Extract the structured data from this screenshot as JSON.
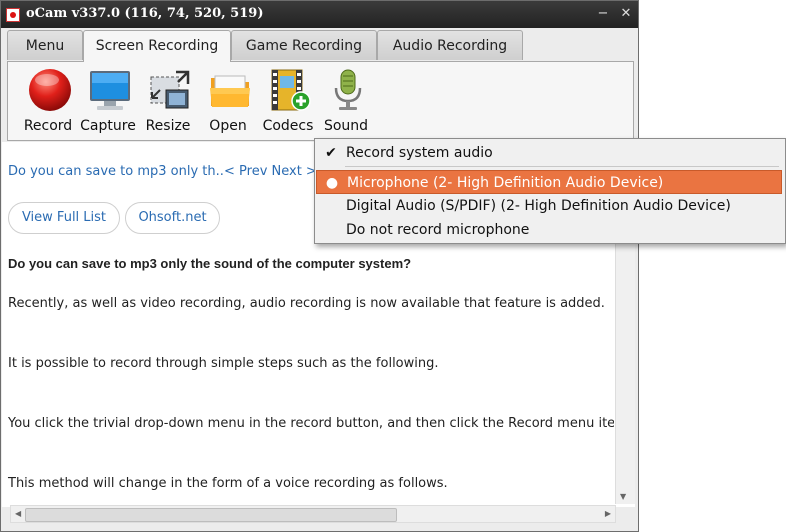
{
  "window": {
    "title": "oCam v337.0 (116, 74, 520, 519)"
  },
  "titlebar_buttons": {
    "minimize": "−",
    "maximize": "□",
    "close": "✕"
  },
  "tabs": [
    {
      "label": "Menu"
    },
    {
      "label": "Screen Recording"
    },
    {
      "label": "Game Recording"
    },
    {
      "label": "Audio Recording"
    }
  ],
  "toolbar": {
    "record": "Record",
    "capture": "Capture",
    "resize": "Resize",
    "open": "Open",
    "codecs": "Codecs",
    "sound": "Sound"
  },
  "content": {
    "faq_link": "Do you can save to mp3 only th..",
    "prev_next": "< Prev Next >",
    "view_full_list": "View Full List",
    "ohsoft": "Ohsoft.net",
    "heading": "Do you can save to mp3 only the sound of the computer system?",
    "p1": "Recently, as well as video recording, audio recording is now available that feature is added.",
    "p2": "It is possible to record through simple steps such as the following.",
    "p3": "You click the trivial drop-down menu in the record button, and then click the Record menu item onl",
    "p4": "This method will change in the form of a voice recording as follows."
  },
  "sound_menu": {
    "items": [
      {
        "label": "Record system audio",
        "mark": "✔",
        "highlighted": false
      },
      {
        "label": "Microphone (2- High Definition Audio Device)",
        "mark": "●",
        "highlighted": true
      },
      {
        "label": "Digital Audio (S/PDIF) (2- High Definition Audio Device)",
        "mark": "",
        "highlighted": false
      },
      {
        "label": "Do not record microphone",
        "mark": "",
        "highlighted": false
      }
    ],
    "highlight_color": "#ea7441"
  },
  "scrollbars": {
    "up": "▲",
    "down": "▼",
    "left": "◀",
    "right": "▶"
  }
}
